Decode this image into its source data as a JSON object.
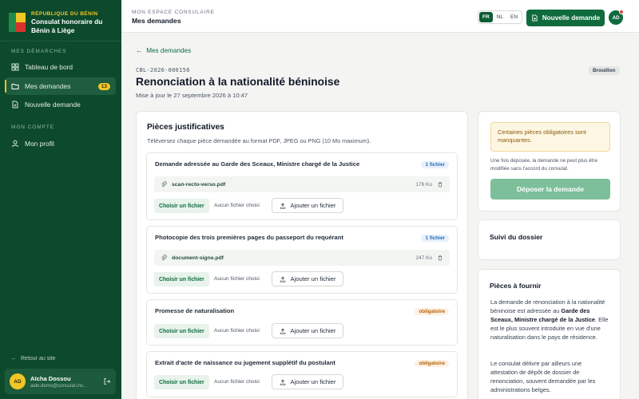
{
  "brand": {
    "country": "RÉPUBLIQUE DU BÉNIN",
    "name": "Consulat honoraire du Bénin à Liège"
  },
  "sidebar": {
    "section1": "MES DÉMARCHES",
    "items": [
      {
        "label": "Tableau de bord",
        "icon": "grid-icon"
      },
      {
        "label": "Mes demandes",
        "icon": "folder-open-icon",
        "badge": "13",
        "active": true
      },
      {
        "label": "Nouvelle demande",
        "icon": "file-plus-icon"
      }
    ],
    "section2": "MON COMPTE",
    "profile": "Mon profil",
    "back": "Retour au site",
    "user": {
      "initials": "AD",
      "name": "Aïcha Dossou",
      "email": "aide.demo@consulat.inv..."
    }
  },
  "topbar": {
    "kicker": "MON ESPACE CONSULAIRE",
    "title": "Mes demandes",
    "langs": [
      "FR",
      "NL",
      "EN"
    ],
    "active_lang": "FR",
    "new_request": "Nouvelle demande",
    "avatar": "AD"
  },
  "header": {
    "back": "Mes demandes",
    "ref": "CBL-2026-000156",
    "status": "Brouillon",
    "title": "Renonciation à la nationalité béninoise",
    "updated": "Mise à jour le 27 septembre 2026 à 10:47"
  },
  "pieces": {
    "title": "Pièces justificatives",
    "subtitle": "Téléversez chaque pièce demandée au format PDF, JPEG ou PNG (10 Mo maximum).",
    "choose_label": "Choisir un fichier",
    "nofile_label": "Aucun fichier choisi",
    "add_label": "Ajouter un fichier",
    "docs": [
      {
        "title": "Demande adressée au Garde des Sceaux, Ministre chargé de la Justice",
        "badge": "1 fichier",
        "file": "scan-recto-verso.pdf",
        "size": "176 Ko"
      },
      {
        "title": "Photocopie des trois premières pages du passeport du requérant",
        "badge": "1 fichier",
        "file": "document-signe.pdf",
        "size": "247 Ko"
      },
      {
        "title": "Promesse de naturalisation",
        "badge": "obligatoire"
      },
      {
        "title": "Extrait d'acte de naissance ou jugement supplétif du postulant",
        "badge": "obligatoire"
      }
    ]
  },
  "side": {
    "alert": "Certaines pièces obligatoires sont manquantes.",
    "note": "Une fois déposée, la demande ne peut plus être modifiée sans l'accord du consulat.",
    "deposit": "Déposer la demande",
    "suivi": "Suivi du dossier",
    "pieces_title": "Pièces à fournir",
    "p1_a": "La demande de renonciation à la nationalité béninoise est adressée au ",
    "p1_b": "Garde des Sceaux, Ministre chargé de la Justice",
    "p1_c": ". Elle est le plus souvent introduite en vue d'une naturalisation dans le pays de résidence.",
    "p2": "Le consulat délivre par ailleurs une attestation de dépôt de dossier de renonciation, souvent demandée par les administrations belges."
  }
}
